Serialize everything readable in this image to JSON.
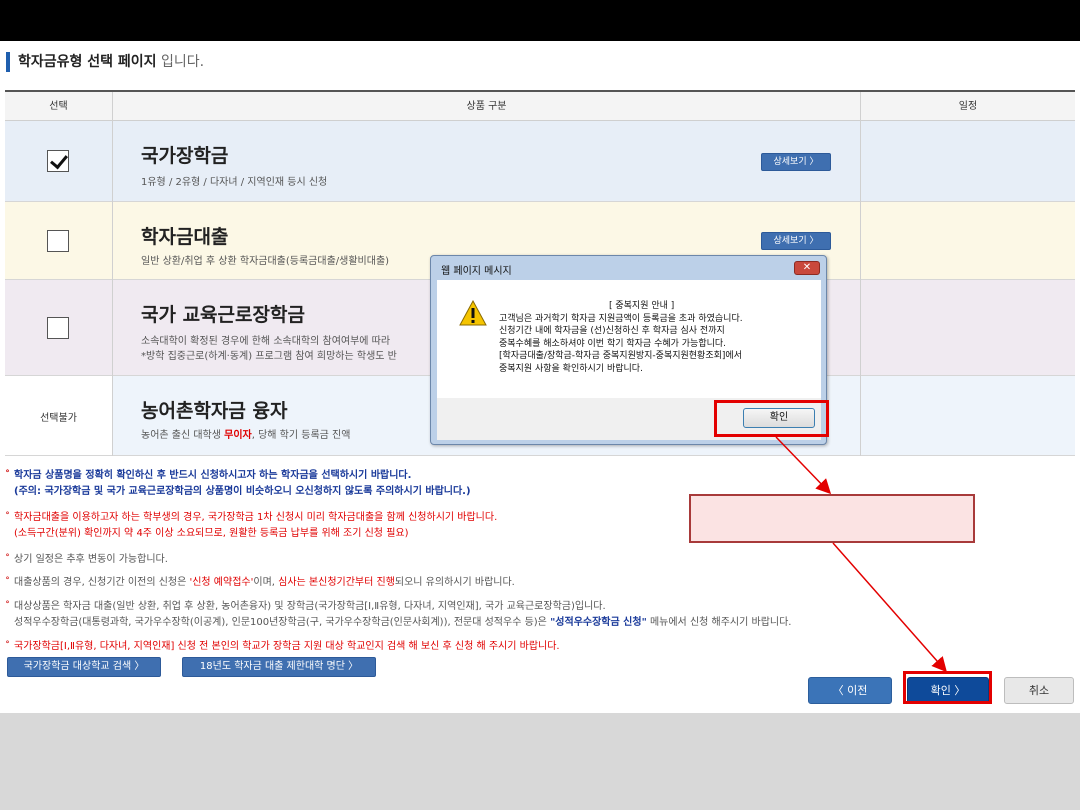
{
  "page": {
    "title_bold": "학자금유형 선택 페이지",
    "title_suffix": "입니다."
  },
  "table": {
    "headers": {
      "select": "선택",
      "product": "상품 구분",
      "schedule": "일정"
    },
    "rows": [
      {
        "name": "국가장학금",
        "desc": "1유형 / 2유형 / 다자녀 / 지역인재 등시 신청",
        "detail": "상세보기 〉",
        "checked": true
      },
      {
        "name": "학자금대출",
        "desc": "일반 상환/취업 후 상환 학자금대출(등록금대출/생활비대출)",
        "detail": "상세보기 〉",
        "checked": false
      },
      {
        "name": "국가 교육근로장학금",
        "desc1": "소속대학이 확정된 경우에 한해 소속대학의 참여여부에 따라",
        "desc2": "*방학 집중근로(하계·동계) 프로그램 참여 희망하는 학생도 반",
        "checked": false
      },
      {
        "name": "농어촌학자금 융자",
        "select_text": "선택불가",
        "desc_pre": "농어촌 출신 대학생 ",
        "desc_red": "무이자",
        "desc_post": ", 당해 학기 등록금 진액"
      }
    ]
  },
  "notes": {
    "n1a": "학자금 상품명을 정확히 확인하신 후 반드시 신청하시고자 하는 학자금을 선택하시기 바랍니다.",
    "n1b": "(주의: 국가장학금 및 국가 교육근로장학금의 상품명이 비슷하오니 오신청하지 않도록 주의하시기 바랍니다.)",
    "n2a": "학자금대출을 이용하고자 하는 학부생의 경우, 국가장학금 1차 신청시 미리 학자금대출을 함께 신청하시기 바랍니다.",
    "n2b": "(소득구간(분위) 확인까지 약 4주 이상 소요되므로, 원활한 등록금 납부를 위해 조기 신청 필요)",
    "n3": "상기 일정은 추후 변동이 가능합니다.",
    "n4a": "대출상품의 경우, 신청기간 이전의 신청은 ",
    "n4b": "'신청 예약접수'",
    "n4c": "이며, ",
    "n4d": "심사는 본신청기간부터 진행",
    "n4e": "되오니 유의하시기 바랍니다.",
    "n5a": "대상상품은 학자금 대출(일반 상환, 취업 후 상환, 농어촌융자) 및 장학금(국가장학금[Ⅰ,Ⅱ유형, 다자녀, 지역인재], 국가 교육근로장학금)입니다.",
    "n5b": "성적우수장학금(대통령과학, 국가우수장학(이공계), 인문100년장학금(구, 국가우수장학금(인문사회계)), 전문대 성적우수 등)은 ",
    "n5c": "\"성적우수장학금 신청\"",
    "n5d": " 메뉴에서 신청 해주시기 바랍니다.",
    "n6": "국가장학금[Ⅰ,Ⅱ유형, 다자녀, 지역인재] 신청 전 본인의 학교가 장학금 지원 대상 학교인지 검색 해 보신 후 신청 해 주시기 바랍니다."
  },
  "links": {
    "school_search": "국가장학금 대상학교 검색 〉",
    "loan_limit": "18년도 학자금 대출 제한대학 명단 〉"
  },
  "nav": {
    "prev": "〈  이전",
    "ok": "확인  〉",
    "cancel": "취소"
  },
  "dialog": {
    "title": "웹 페이지 메시지",
    "close": "✕",
    "heading": "[ 중복지원 안내 ]",
    "lines": [
      "고객님은 과거학기 학자금 지원금액이 등록금을 초과 하였습니다.",
      "신청기간 내에 학자금을 (선)신청하신 후 학자금 심사 전까지",
      "중복수혜를 해소하셔야 이번 학기 학자금 수혜가 가능합니다.",
      "[학자금대출/장학금-학자금 중복지원방지-중복지원현황조회]에서",
      "중복지원 사항을 확인하시기 바랍니다."
    ],
    "ok": "확인"
  },
  "colors": {
    "accent": "#1f5fae",
    "highlight": "#e30000",
    "callout_fill": "#fbe3e3"
  },
  "icons": [
    "checkbox-checked-icon",
    "warning-icon",
    "close-icon"
  ]
}
